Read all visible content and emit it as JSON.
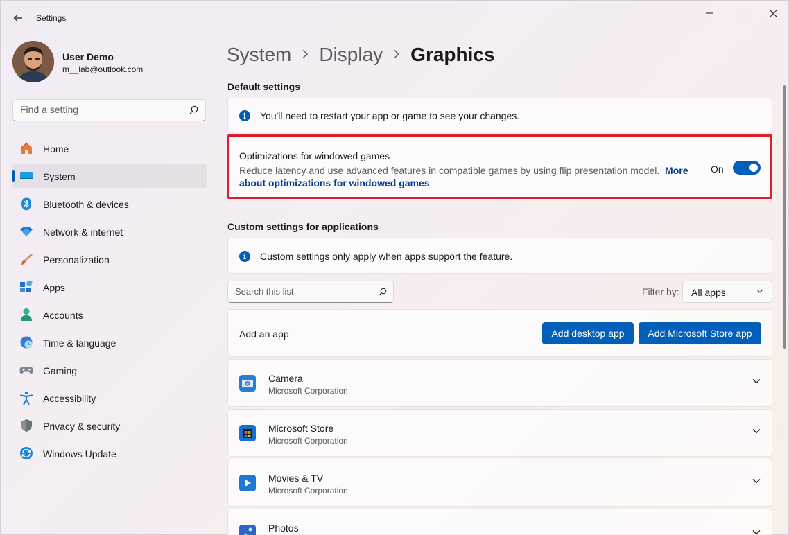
{
  "window": {
    "title": "Settings"
  },
  "user": {
    "name": "User Demo",
    "email": "m__lab@outlook.com"
  },
  "search": {
    "placeholder": "Find a setting"
  },
  "nav": {
    "items": [
      {
        "label": "Home",
        "icon": "home-icon"
      },
      {
        "label": "System",
        "icon": "system-icon",
        "selected": true
      },
      {
        "label": "Bluetooth & devices",
        "icon": "bluetooth-icon"
      },
      {
        "label": "Network & internet",
        "icon": "network-icon"
      },
      {
        "label": "Personalization",
        "icon": "personalization-icon"
      },
      {
        "label": "Apps",
        "icon": "apps-icon"
      },
      {
        "label": "Accounts",
        "icon": "accounts-icon"
      },
      {
        "label": "Time & language",
        "icon": "time-language-icon"
      },
      {
        "label": "Gaming",
        "icon": "gaming-icon"
      },
      {
        "label": "Accessibility",
        "icon": "accessibility-icon"
      },
      {
        "label": "Privacy & security",
        "icon": "privacy-icon"
      },
      {
        "label": "Windows Update",
        "icon": "windows-update-icon"
      }
    ]
  },
  "breadcrumb": {
    "items": [
      "System",
      "Display"
    ],
    "current": "Graphics"
  },
  "default_settings": {
    "title": "Default settings",
    "info": "You'll need to restart your app or game to see your changes.",
    "optimizations": {
      "title": "Optimizations for windowed games",
      "description": "Reduce latency and use advanced features in compatible games by using flip presentation model.",
      "link": "More about optimizations for windowed games",
      "state_label": "On",
      "enabled": true
    }
  },
  "custom_settings": {
    "title": "Custom settings for applications",
    "info": "Custom settings only apply when apps support the feature.",
    "search_placeholder": "Search this list",
    "filter_label": "Filter by:",
    "filter_value": "All apps",
    "add_app": {
      "label": "Add an app",
      "desktop_button": "Add desktop app",
      "store_button": "Add Microsoft Store app"
    },
    "apps": [
      {
        "name": "Camera",
        "publisher": "Microsoft Corporation",
        "icon": "camera-icon"
      },
      {
        "name": "Microsoft Store",
        "publisher": "Microsoft Corporation",
        "icon": "store-icon"
      },
      {
        "name": "Movies & TV",
        "publisher": "Microsoft Corporation",
        "icon": "movies-tv-icon"
      },
      {
        "name": "Photos",
        "publisher": "",
        "icon": "photos-icon"
      }
    ]
  },
  "colors": {
    "accent": "#005fb8",
    "highlight_border": "#d8202d"
  }
}
